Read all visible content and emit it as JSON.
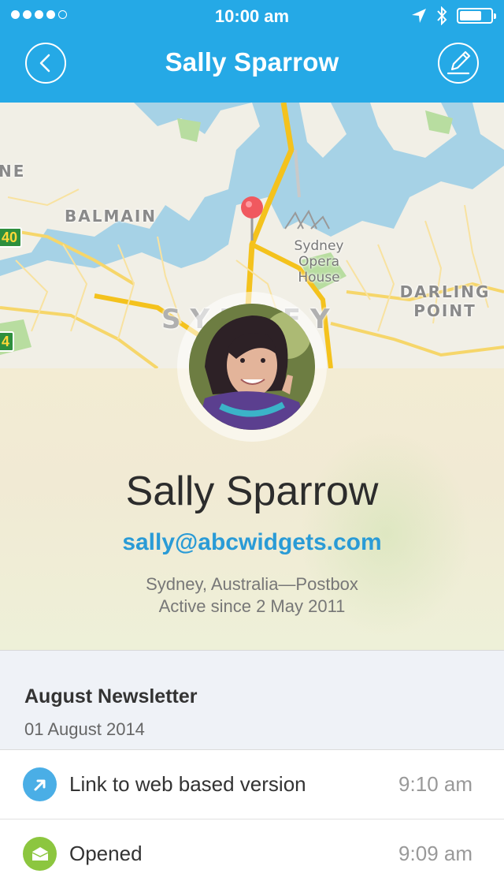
{
  "status_bar": {
    "time": "10:00 am",
    "signal_dots_filled": 4,
    "signal_dots_total": 5,
    "battery_level": 0.7
  },
  "header": {
    "title": "Sally Sparrow",
    "back_icon": "chevron-left-icon",
    "edit_icon": "compose-icon",
    "background_color": "#25a9e6"
  },
  "map": {
    "labels": [
      "NE",
      "BALMAIN",
      "SYDNEY",
      "DARLING POINT"
    ],
    "poi": "Sydney Opera House",
    "road_shields": [
      "40",
      "4"
    ]
  },
  "profile": {
    "name": "Sally Sparrow",
    "email": "sally@abcwidgets.com",
    "location": "Sydney, Australia—Postbox",
    "active_since": "Active since 2 May 2011",
    "email_color": "#2a9bd6"
  },
  "campaign": {
    "title": "August Newsletter",
    "date": "01 August 2014",
    "activity": [
      {
        "icon": "link-arrow-icon",
        "label": "Link to web based version",
        "time": "9:10 am",
        "color": "#4aaee6"
      },
      {
        "icon": "envelope-open-icon",
        "label": "Opened",
        "time": "9:09 am",
        "color": "#8cc63f"
      }
    ]
  }
}
